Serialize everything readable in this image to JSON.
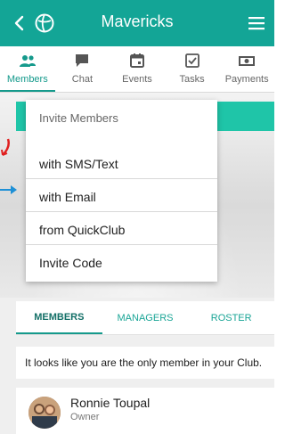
{
  "header": {
    "title": "Mavericks"
  },
  "tabs": [
    {
      "label": "Members",
      "icon": "people-icon",
      "active": true
    },
    {
      "label": "Chat",
      "icon": "chat-icon",
      "active": false
    },
    {
      "label": "Events",
      "icon": "calendar-icon",
      "active": false
    },
    {
      "label": "Tasks",
      "icon": "checkbox-icon",
      "active": false
    },
    {
      "label": "Payments",
      "icon": "money-icon",
      "active": false
    }
  ],
  "dropdown": {
    "header": "Invite Members",
    "items": [
      "with SMS/Text",
      "with Email",
      "from QuickClub",
      "Invite Code"
    ]
  },
  "lower_tabs": [
    "MEMBERS",
    "MANAGERS",
    "ROSTER"
  ],
  "notice": "It looks like you are the only member in your Club.",
  "member": {
    "name": "Ronnie Toupal",
    "role": "Owner"
  },
  "colors": {
    "brand": "#13a596",
    "accent": "#1fc5a8",
    "annotation_red": "#e02020",
    "annotation_blue": "#1e90d6"
  }
}
